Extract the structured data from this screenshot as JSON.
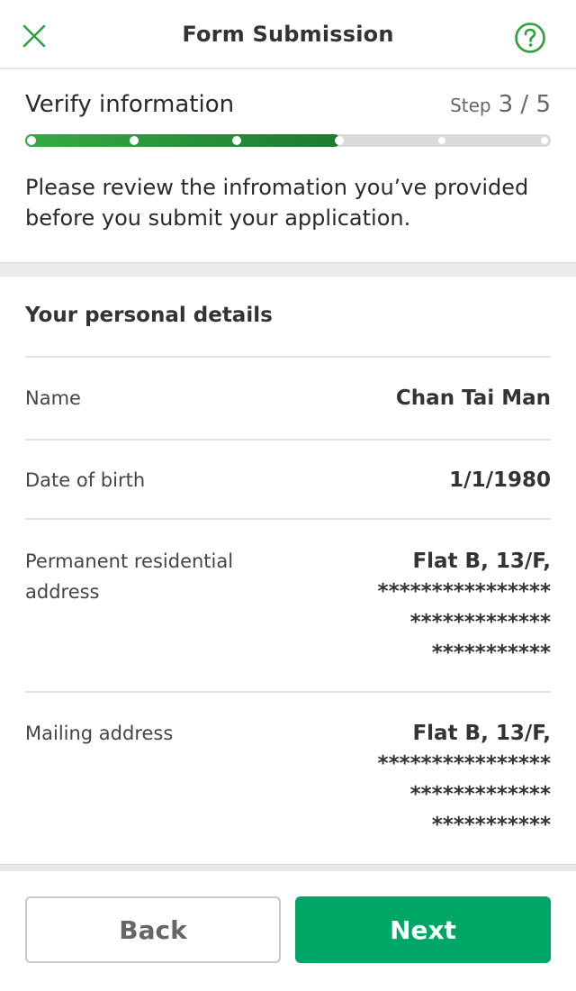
{
  "header": {
    "title": "Form Submission",
    "close_icon": "close-icon",
    "help_icon": "help-circle-icon",
    "accent_color": "#2ea13f"
  },
  "step": {
    "title": "Verify information",
    "word": "Step",
    "current": 3,
    "total": 5,
    "counter_text": "3 / 5",
    "progress_fraction": 0.6,
    "description": "Please review the infromation you’ve provided before you submit your application."
  },
  "personal": {
    "section_title": "Your personal details",
    "name": {
      "label": "Name",
      "value": "Chan Tai Man"
    },
    "dob": {
      "label": "Date of birth",
      "value": "1/1/1980"
    },
    "permanent_address": {
      "label": "Permanent residential address",
      "lines": [
        "Flat B, 13/F,",
        "****************",
        "*************",
        "***********"
      ]
    },
    "mailing_address": {
      "label": "Mailing address",
      "lines": [
        "Flat B, 13/F,",
        "****************",
        "*************",
        "***********"
      ]
    }
  },
  "footer": {
    "back_label": "Back",
    "next_label": "Next",
    "next_color": "#00a665"
  }
}
